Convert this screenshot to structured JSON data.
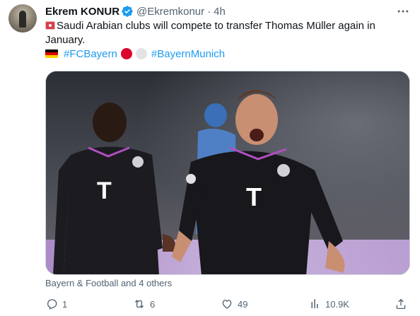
{
  "tweet": {
    "author_name": "Ekrem KONUR",
    "author_handle": "@Ekremkonur",
    "separator": "·",
    "time": "4h",
    "text": "Saudi Arabian clubs will compete to transfer Thomas Müller again in January.",
    "hashtags": [
      "#FCBayern",
      "#BayernMunich"
    ],
    "media_caption": "Bayern & Football and 4 others"
  },
  "actions": {
    "replies": "1",
    "retweets": "6",
    "likes": "49",
    "views": "10.9K"
  },
  "icons": {
    "verified": "verified-badge-icon",
    "more": "more-icon",
    "reply": "reply-icon",
    "retweet": "retweet-icon",
    "like": "heart-icon",
    "views": "analytics-icon",
    "share": "share-icon"
  },
  "colors": {
    "accent": "#1d9bf0",
    "text": "#0f1419",
    "muted": "#536471",
    "bayern_red": "#dc052d"
  }
}
